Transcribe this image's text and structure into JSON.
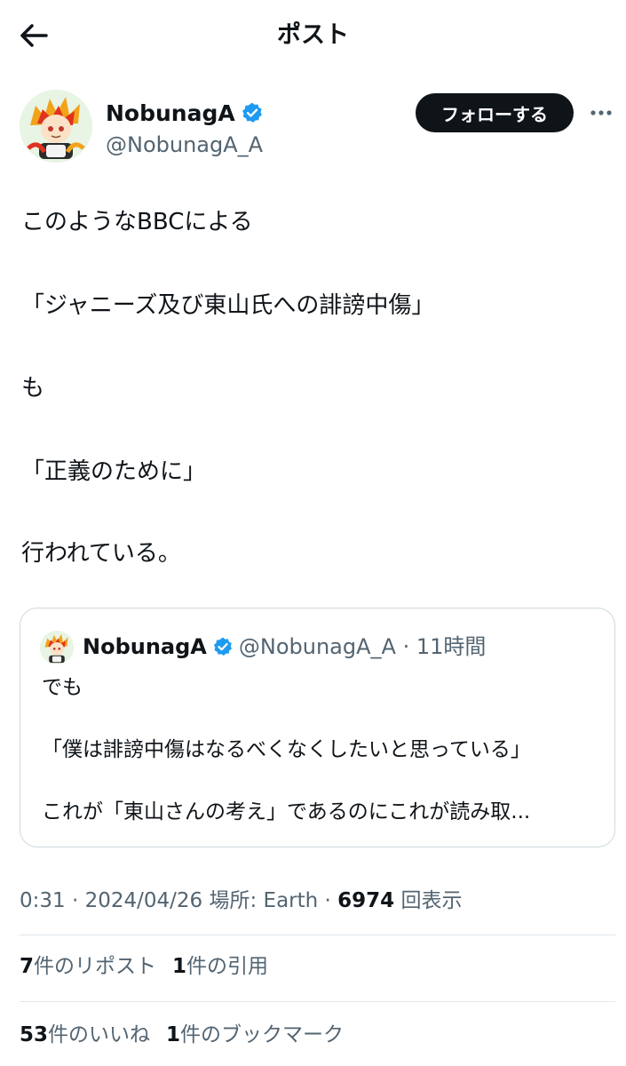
{
  "header": {
    "title": "ポスト",
    "back_icon": "arrow-left-icon"
  },
  "author": {
    "name": "NobunagA",
    "handle": "@NobunagA_A",
    "verified_icon": "verified-badge-icon",
    "verified_color": "#1d9bf0"
  },
  "follow_button": {
    "label": "フォローする"
  },
  "more_icon": "more-horizontal-icon",
  "post": {
    "lines": [
      "このようなBBCによる",
      "「ジャニーズ及び東山氏への誹謗中傷」",
      "も",
      "「正義のために」",
      "行われている。"
    ]
  },
  "quote": {
    "name": "NobunagA",
    "handle": "@NobunagA_A",
    "time": "11時間",
    "lines": [
      "でも",
      "「僕は誹謗中傷はなるべくなくしたいと思っている」",
      "これが「東山さんの考え」であるのにこれが読み取..."
    ]
  },
  "meta": {
    "time": "0:31",
    "date": "2024/04/26",
    "location_label": "場所: Earth",
    "views": "6974",
    "views_label": "回表示"
  },
  "stats": {
    "reposts_count": "7",
    "reposts_label": "件のリポスト",
    "quotes_count": "1",
    "quotes_label": "件の引用",
    "likes_count": "53",
    "likes_label": "件のいいね",
    "bookmarks_count": "1",
    "bookmarks_label": "件のブックマーク"
  },
  "colors": {
    "text": "#0f1419",
    "secondary": "#536471",
    "accent": "#1d9bf0",
    "border": "#cfd9de"
  }
}
